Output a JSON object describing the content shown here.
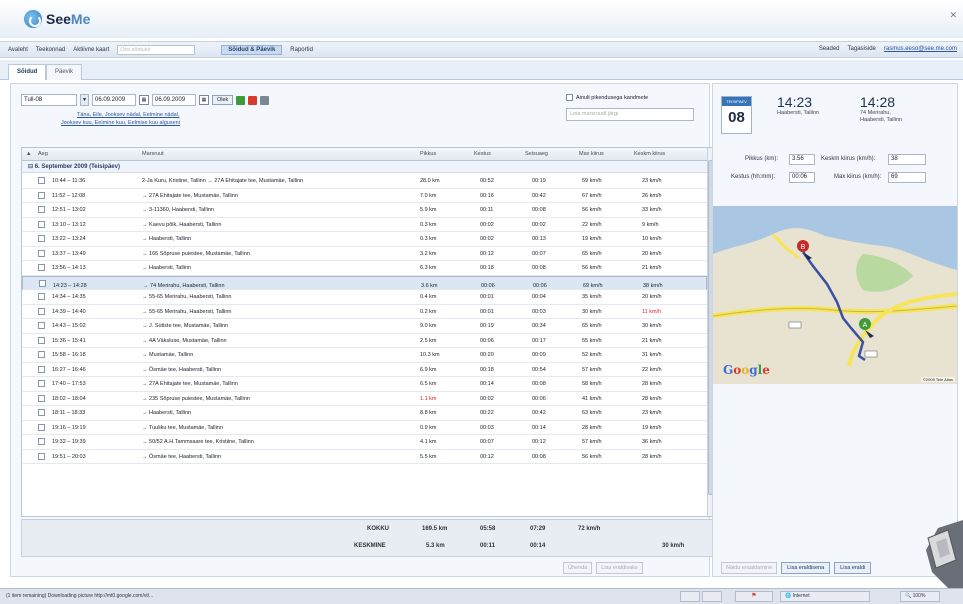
{
  "app": {
    "logo_see": "See",
    "logo_me": "Me"
  },
  "nav": {
    "items": [
      "Avaleht",
      "Teekonnad",
      "Aktiivne kaart"
    ],
    "search_placeholder": "Otsi sõidukit",
    "active_item": "Sõidud & Päevik",
    "reports": "Raportid",
    "settings": "Seaded",
    "help": "Tagasiside",
    "user_email": "rasmus.eeso@see.me.com"
  },
  "subtabs": [
    "Sõidud",
    "Päevik"
  ],
  "filter": {
    "period": "Tull-08",
    "date_from": "06.09.2009",
    "date_to": "06.09.2009",
    "ok": "Olek",
    "links": [
      "Täna",
      "Eile",
      "Jooksev nädal",
      "Eelmine nädal",
      "Jooksev kuu",
      "Eelmine kuu",
      "Eelmise kuu alguseni"
    ],
    "only_registered": "Ainult pikendusega kandmete",
    "driver_placeholder": "Leia marsruudi järgi"
  },
  "table": {
    "columns": [
      "Aeg",
      "Marsruut",
      "Pikkus",
      "Kestus",
      "Seisuaeg",
      "Max kiirus",
      "Keskm kiirus"
    ],
    "group_label": "6. September 2009 (Teisipäev)",
    "rows": [
      {
        "time": "10:44 – 11:36",
        "route": "2-Ja Kuru, Kristine, Tallinn → 27A Ehitajate tee, Mustamäe, Tallinn",
        "len": "28.0 km",
        "dur": "00:52",
        "stop": "00:19",
        "max": "59 km/h",
        "avg": "23 km/h"
      },
      {
        "time": "11:52 – 12:08",
        "route": "→ 27A Ehitajate tee, Mustamäe, Tallinn",
        "len": "7.0 km",
        "dur": "00:16",
        "stop": "00:42",
        "max": "67 km/h",
        "avg": "26 km/h"
      },
      {
        "time": "12:51 – 13:02",
        "route": "→ 3-11360, Haabersti, Tallinn",
        "len": "5.9 km",
        "dur": "00:11",
        "stop": "00:08",
        "max": "56 km/h",
        "avg": "33 km/h"
      },
      {
        "time": "13:10 – 13:12",
        "route": "→ Kaevu põik, Haabersti, Tallinn",
        "len": "0.3 km",
        "dur": "00:02",
        "stop": "00:02",
        "max": "22 km/h",
        "avg": "9 km/h"
      },
      {
        "time": "13:22 – 13:24",
        "route": "→ Haabersti, Tallinn",
        "len": "0.3 km",
        "dur": "00:02",
        "stop": "00:13",
        "max": "19 km/h",
        "avg": "10 km/h"
      },
      {
        "time": "13:37 – 13:49",
        "route": "→ 166 Sõpruse puiestee, Mustamäe, Tallinn",
        "len": "3.2 km",
        "dur": "00:12",
        "stop": "00:07",
        "max": "65 km/h",
        "avg": "20 km/h"
      },
      {
        "time": "13:56 – 14:13",
        "route": "→ Haabersti, Tallinn",
        "len": "6.3 km",
        "dur": "00:18",
        "stop": "00:08",
        "max": "56 km/h",
        "avg": "21 km/h"
      },
      {
        "time": "14:23 – 14:28",
        "route": "→ 74 Merirahu, Haabersti, Tallinn",
        "len": "3.6 km",
        "dur": "00:06",
        "stop": "00:06",
        "max": "69 km/h",
        "avg": "38 km/h"
      },
      {
        "time": "14:34 – 14:35",
        "route": "→ 55-65 Merirahu, Haabersti, Tallinn",
        "len": "0.4 km",
        "dur": "00:01",
        "stop": "00:04",
        "max": "35 km/h",
        "avg": "20 km/h"
      },
      {
        "time": "14:39 – 14:40",
        "route": "→ 55-65 Merirahu, Haabersti, Tallinn",
        "len": "0.2 km",
        "dur": "00:01",
        "stop": "00:03",
        "max": "30 km/h",
        "avg": "11 km/h",
        "avg_red": true
      },
      {
        "time": "14:43 – 15:02",
        "route": "→ J. Sütiste tee, Mustamäe, Tallinn",
        "len": "9.0 km",
        "dur": "00:19",
        "stop": "00:34",
        "max": "65 km/h",
        "avg": "30 km/h"
      },
      {
        "time": "15:36 – 15:41",
        "route": "→ 4A Väksluse, Mustamäe, Tallinn",
        "len": "2.5 km",
        "dur": "00:06",
        "stop": "00:17",
        "max": "55 km/h",
        "avg": "21 km/h"
      },
      {
        "time": "15:58 – 16:18",
        "route": "→ Mustamäe, Tallinn",
        "len": "10.3 km",
        "dur": "00:20",
        "stop": "00:09",
        "max": "52 km/h",
        "avg": "31 km/h"
      },
      {
        "time": "16:27 – 16:46",
        "route": "→ Ösmäe tee, Haabersti, Tallinn",
        "len": "6.9 km",
        "dur": "00:18",
        "stop": "00:54",
        "max": "57 km/h",
        "avg": "22 km/h"
      },
      {
        "time": "17:40 – 17:53",
        "route": "→ 27A Ehitajate tee, Mustamäe, Tallinn",
        "len": "6.5 km",
        "dur": "00:14",
        "stop": "00:08",
        "max": "58 km/h",
        "avg": "28 km/h"
      },
      {
        "time": "18:02 – 18:04",
        "route": "→ 235 Sõpruse puiestee, Mustamäe, Tallinn",
        "len": "1.1 km",
        "dur": "00:02",
        "stop": "00:06",
        "max": "41 km/h",
        "avg": "28 km/h",
        "len_red": true
      },
      {
        "time": "18:11 – 18:33",
        "route": "→ Haabersti, Tallinn",
        "len": "8.8 km",
        "dur": "00:22",
        "stop": "00:42",
        "max": "63 km/h",
        "avg": "23 km/h"
      },
      {
        "time": "19:16 – 19:19",
        "route": "→ Tuuliku tee, Mustamäe, Tallinn",
        "len": "0.9 km",
        "dur": "00:03",
        "stop": "00:14",
        "max": "28 km/h",
        "avg": "19 km/h"
      },
      {
        "time": "19:32 – 19:39",
        "route": "→ 50/52 A.H.Tammsaare tee, Kristiine, Tallinn",
        "len": "4.1 km",
        "dur": "00:07",
        "stop": "00:12",
        "max": "57 km/h",
        "avg": "36 km/h"
      },
      {
        "time": "19:51 – 20:03",
        "route": "→ Ösmäe tee, Haabersti, Tallinn",
        "len": "5.5 km",
        "dur": "00:12",
        "stop": "00:08",
        "max": "56 km/h",
        "avg": "28 km/h"
      }
    ],
    "selected_index": 7
  },
  "totals": {
    "sum_label": "KOKKU",
    "sum_len": "169.5 km",
    "sum_dur": "05:58",
    "sum_stop": "07:29",
    "sum_max": "72 km/h",
    "avg_label": "KESKMINE",
    "avg_len": "5.3 km",
    "avg_dur": "00:11",
    "avg_stop": "00:14",
    "avg_speed": "30 km/h"
  },
  "left_actions": [
    "Ühenda",
    "Lisa eraldisaks"
  ],
  "detail": {
    "weekday": "TEISIPÄEV",
    "day": "08",
    "start_time": "14:23",
    "start_place": "Haabersti, Tallinn",
    "end_time": "14:28",
    "end_place_1": "74 Merirahu,",
    "end_place_2": "Haabersti, Tallinn",
    "len_label": "Pikkus (km):",
    "len_value": "3.56",
    "avg_label": "Keskm kiirus (km/h):",
    "avg_value": "38",
    "dur_label": "Kestus (hh:mm):",
    "dur_value": "00:06",
    "max_label": "Max kiirus (km/h):",
    "max_value": "69"
  },
  "map": {
    "google": "Google",
    "attribution": "©2009 Tele Atlas",
    "marker_a": "A",
    "marker_b": "B"
  },
  "right_actions": [
    "Näidu eraaldamine",
    "Lisa eraldisena",
    "Lisa eraldi"
  ],
  "status": {
    "text": "(1 item remaining) Downloading picture http://mt0.google.com/vt/...",
    "zone": "Internet",
    "zoom": "100%"
  },
  "colors": {
    "accent": "#3775bb",
    "route": "#3b4fa3",
    "road": "#f6e55a",
    "water": "#a9c7e2",
    "land": "#e8e2d0",
    "park": "#b8d9a0"
  }
}
